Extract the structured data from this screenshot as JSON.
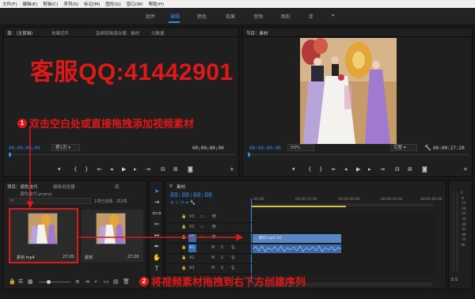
{
  "menu": [
    "文件(F)",
    "编辑(E)",
    "剪辑(C)",
    "序列(S)",
    "标记(M)",
    "图形(G)",
    "窗口(W)",
    "帮助(H)"
  ],
  "workspaces": [
    "组件",
    "编辑",
    "颜色",
    "效果",
    "音频",
    "图形",
    "库"
  ],
  "workspace_active": "编辑",
  "workspace_more": "»",
  "source_panel": {
    "tabs": [
      "源：（无剪辑）",
      "效果控件",
      "音频剪辑混合器：素材",
      "元数据"
    ],
    "timecode_left": "00;00;00;00",
    "timecode_right": "00;00;00;00",
    "page_select": "第1页"
  },
  "program_panel": {
    "title": "节目：素材",
    "timecode_left": "00:00:00:00",
    "zoom": "50%",
    "quality": "完整",
    "timecode_right": "00:00:27:20"
  },
  "project_panel": {
    "tabs": [
      "项目：调色技巧",
      "媒体浏览器",
      "库"
    ],
    "project_file": "调色技巧.prproj",
    "selection_info": "1项已选择，共2项",
    "items": [
      {
        "name": "素材.mp4",
        "duration": "27:20"
      },
      {
        "name": "素材",
        "duration": "27:20"
      }
    ]
  },
  "timeline": {
    "tab": "素材",
    "timecode": "00:00:00:00",
    "ruler": [
      ":00:00",
      "00:00:15:00",
      "00:00:30:00",
      "00:00:45:00",
      "00:01:00:00"
    ],
    "video_tracks": [
      "V3",
      "V2",
      "V1"
    ],
    "audio_tracks": [
      "A1",
      "A2",
      "A3"
    ],
    "clip_label": "素材.mp4 [V]",
    "meter_labels": [
      "0",
      "-6",
      "-12",
      "-18",
      "-24",
      "-30",
      "-36",
      "-42",
      "-48",
      "-54",
      "dB"
    ]
  },
  "overlay": {
    "contact": "客服QQ:41442901",
    "step1_num": "1",
    "step1": "双击空白处或直接拖拽添加视频素材",
    "step2_num": "2",
    "step2": "将视频素材拖拽到右下方创建序列"
  },
  "colors": {
    "accent": "#2d8ceb",
    "annotation": "#e01818",
    "panel": "#1f1f1f",
    "clip_video": "#5b86c4",
    "clip_audio": "#3f6aa8"
  }
}
